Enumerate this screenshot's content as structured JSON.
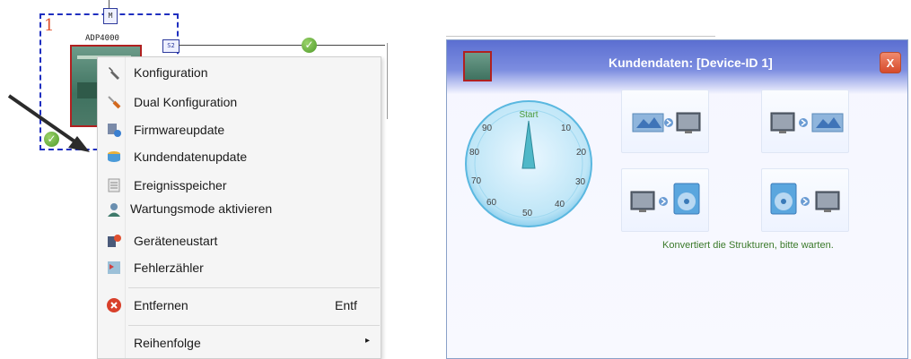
{
  "diagram": {
    "device_number": "1",
    "port_m": "M",
    "device_name": "ADP4000",
    "port_s2": "S2"
  },
  "context_menu": {
    "items": [
      {
        "label": "Konfiguration",
        "icon": "wrench-icon",
        "shortcut": ""
      },
      {
        "label": "Dual Konfiguration",
        "icon": "screwdriver-icon",
        "shortcut": ""
      },
      {
        "label": "Firmwareupdate",
        "icon": "firmware-update-icon",
        "shortcut": ""
      },
      {
        "label": "Kundendatenupdate",
        "icon": "database-icon",
        "shortcut": ""
      },
      {
        "label": "Ereignisspeicher",
        "icon": "event-log-icon",
        "shortcut": ""
      },
      {
        "label": "Wartungsmode aktivieren",
        "icon": "maintenance-person-icon",
        "shortcut": ""
      },
      {
        "label": "Geräteneustart",
        "icon": "restart-device-icon",
        "shortcut": ""
      },
      {
        "label": "Fehlerzähler",
        "icon": "error-counter-icon",
        "shortcut": ""
      },
      {
        "label": "Entfernen",
        "icon": "remove-icon",
        "shortcut": "Entf"
      },
      {
        "label": "Reihenfolge",
        "icon": "",
        "shortcut": "▸"
      }
    ]
  },
  "dialog": {
    "title": "Kundendaten: [Device-ID 1]",
    "close_label": "X",
    "dial": {
      "start_label": "Start",
      "marks": [
        "10",
        "20",
        "30",
        "40",
        "50",
        "60",
        "70",
        "80",
        "90"
      ]
    },
    "status_text": "Konvertiert die Strukturen, bitte warten."
  },
  "colors": {
    "dashed_border": "#1f2fc0",
    "device_number": "#e0532d",
    "title_bar": "#5b6fd1",
    "status_text": "#3b7a2a",
    "close_button": "#d64a2b"
  }
}
